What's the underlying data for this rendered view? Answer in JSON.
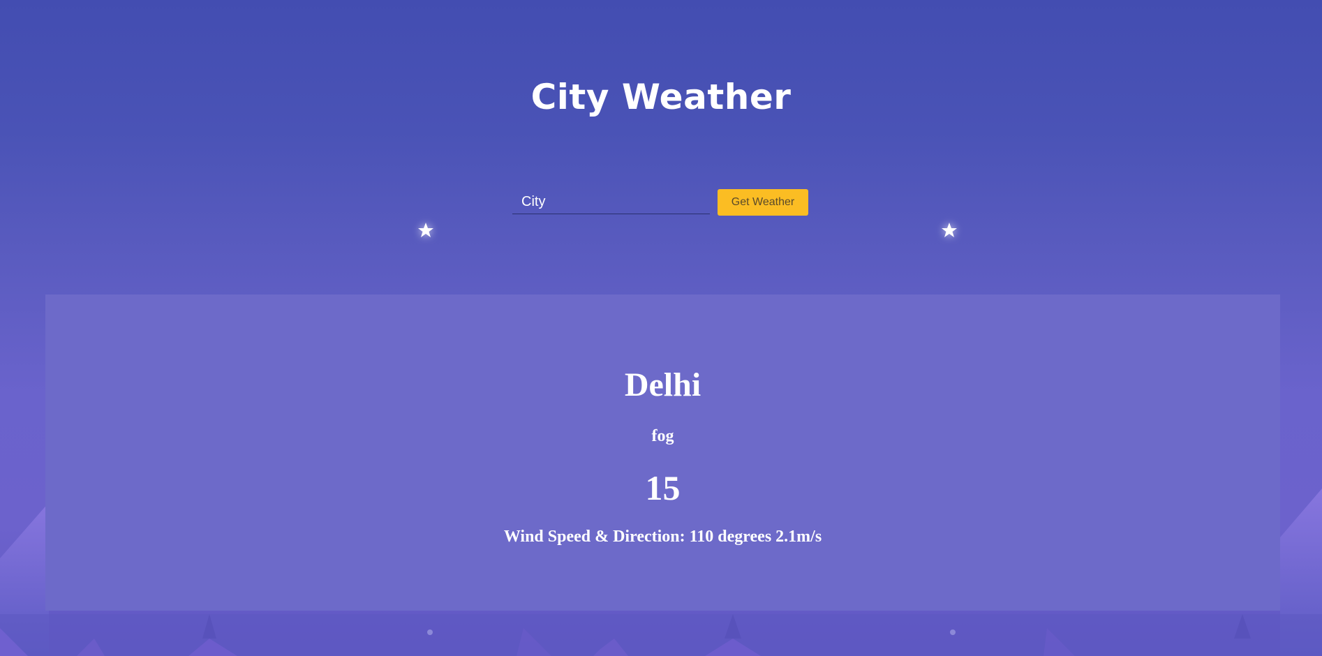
{
  "header": {
    "title": "City Weather"
  },
  "search": {
    "placeholder": "City",
    "value": "",
    "button_label": "Get Weather"
  },
  "weather": {
    "city": "Delhi",
    "condition": "fog",
    "temperature": "15",
    "wind": "Wind Speed & Direction: 110 degrees 2.1m/s"
  },
  "icons": {
    "left_star": "star-icon",
    "right_star": "star-icon"
  },
  "colors": {
    "background_top": "#434db1",
    "background_bottom": "#6c62cc",
    "card": "#6d6ac9",
    "button": "#fbbd23",
    "text": "#ffffff"
  }
}
